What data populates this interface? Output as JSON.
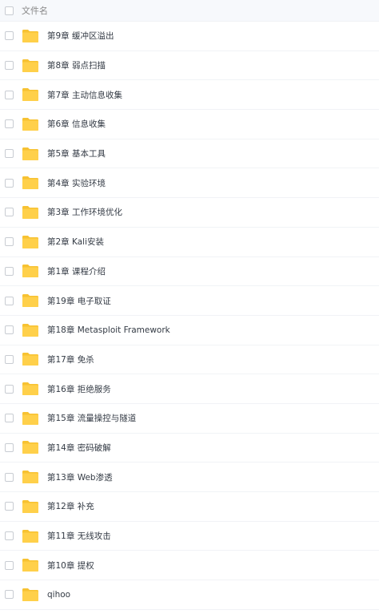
{
  "header": {
    "column_label": "文件名"
  },
  "icons": {
    "folder": "folder-icon",
    "folder_color": "#FFD04A",
    "folder_tab_color": "#F7C232"
  },
  "files": [
    {
      "name": "第9章 缓冲区溢出"
    },
    {
      "name": "第8章 弱点扫描"
    },
    {
      "name": "第7章 主动信息收集"
    },
    {
      "name": "第6章 信息收集"
    },
    {
      "name": "第5章 基本工具"
    },
    {
      "name": "第4章 实验环境"
    },
    {
      "name": "第3章 工作环境优化"
    },
    {
      "name": "第2章 Kali安装"
    },
    {
      "name": "第1章 课程介绍"
    },
    {
      "name": "第19章 电子取证"
    },
    {
      "name": "第18章 Metasploit Framework"
    },
    {
      "name": "第17章 免杀"
    },
    {
      "name": "第16章 拒绝服务"
    },
    {
      "name": "第15章 流量操控与隧道"
    },
    {
      "name": "第14章 密码破解"
    },
    {
      "name": "第13章 Web渗透"
    },
    {
      "name": "第12章 补充"
    },
    {
      "name": "第11章 无线攻击"
    },
    {
      "name": "第10章 提权"
    },
    {
      "name": "qihoo"
    }
  ]
}
